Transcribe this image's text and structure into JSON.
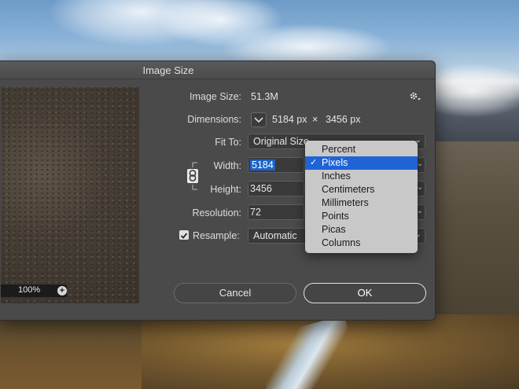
{
  "dialog": {
    "title": "Image Size",
    "image_size_label": "Image Size:",
    "image_size_value": "51.3M",
    "dimensions_label": "Dimensions:",
    "dim_width": "5184 px",
    "dim_x": "×",
    "dim_height": "3456 px",
    "fit_to_label": "Fit To:",
    "fit_to_value": "Original Size",
    "width_label": "Width:",
    "width_value": "5184",
    "height_label": "Height:",
    "height_value": "3456",
    "resolution_label": "Resolution:",
    "resolution_value": "72",
    "resample_label": "Resample:",
    "resample_checked": true,
    "resample_value": "Automatic",
    "cancel_label": "Cancel",
    "ok_label": "OK"
  },
  "preview": {
    "zoom": "100%",
    "zoom_plus": "+"
  },
  "units_menu": {
    "items": [
      "Percent",
      "Pixels",
      "Inches",
      "Centimeters",
      "Millimeters",
      "Points",
      "Picas",
      "Columns"
    ],
    "selected": "Pixels"
  },
  "icons": {
    "gear": "gear-icon",
    "chain": "link-icon",
    "check": "checkmark-icon"
  },
  "colors": {
    "accent": "#1f63d6",
    "dialog_bg": "#4a4a4a"
  }
}
